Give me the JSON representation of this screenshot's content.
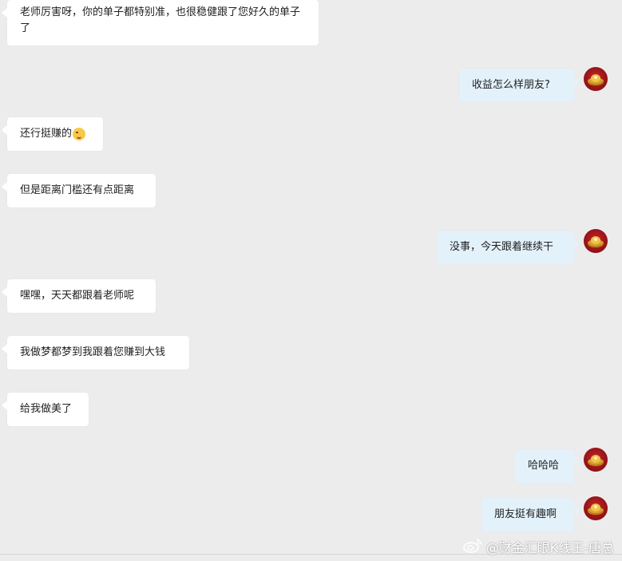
{
  "messages": [
    {
      "side": "in",
      "text": "老师厉害呀，你的单子都特别准，也很稳健跟了您好久的单子了"
    },
    {
      "side": "out",
      "text": "收益怎么样朋友?"
    },
    {
      "side": "in",
      "text": "还行挺赚的"
    },
    {
      "side": "in",
      "text": "但是距离门槛还有点距离"
    },
    {
      "side": "out",
      "text": "没事，今天跟着继续干"
    },
    {
      "side": "in",
      "text": "嘿嘿，天天都跟着老师呢"
    },
    {
      "side": "in",
      "text": "我做梦都梦到我跟着您赚到大钱"
    },
    {
      "side": "in",
      "text": "给我做美了"
    },
    {
      "side": "out",
      "text": "哈哈哈"
    },
    {
      "side": "out",
      "text": "朋友挺有趣啊"
    }
  ],
  "watermark": {
    "text": "@财金汇眼K线王-唐总"
  },
  "icons": {
    "emoji": "smiling-face-emoji",
    "avatar": "gold-ingot-avatar",
    "watermark_logo": "weibo-logo"
  },
  "colors": {
    "background": "#ececec",
    "incoming_bubble": "#ffffff",
    "outgoing_bubble": "#e3f1fb",
    "avatar_red": "#8e1116",
    "avatar_gold": "#d9a12a"
  }
}
